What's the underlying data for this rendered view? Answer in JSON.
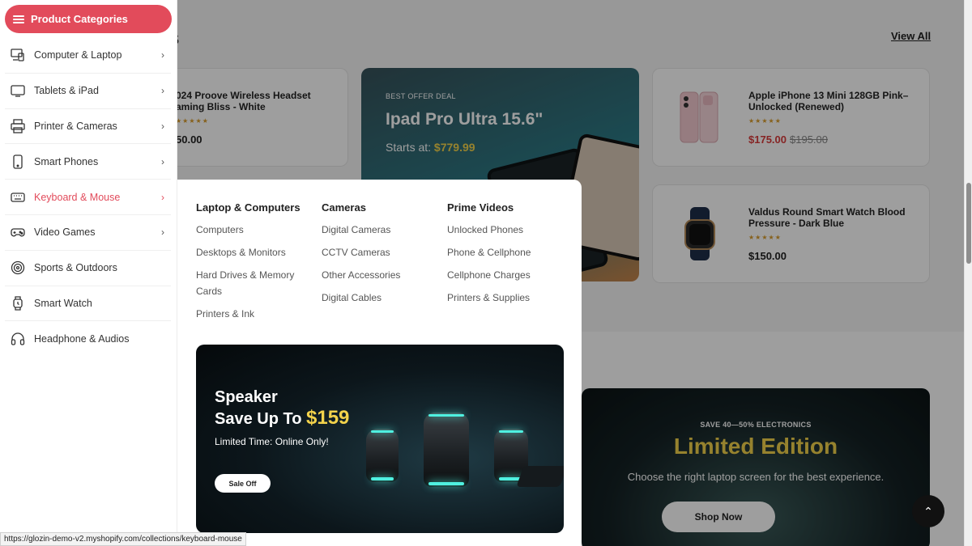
{
  "background": {
    "section_heading_partial": "s",
    "view_all": "View All",
    "products": [
      {
        "title": "024 Proove Wireless Headset\naming Bliss - White",
        "price": "50.00"
      },
      {
        "title": "Apple iPhone 13 Mini 128GB Pink–\nUnlocked (Renewed)",
        "price": "$175.00",
        "old_price": "$195.00"
      },
      {
        "title": "Valdus Round Smart Watch Blood\nPressure - Dark Blue",
        "price": "$150.00"
      }
    ],
    "promo": {
      "eyebrow": "BEST OFFER DEAL",
      "title": "Ipad Pro Ultra 15.6\"",
      "starts_label": "Starts at:",
      "starts_price": "$779.99"
    },
    "banner2": {
      "eyebrow": "SAVE 40—50% ELECTRONICS",
      "title": "Limited Edition",
      "subtitle": "Choose the right laptop screen for the best experience.",
      "button": "Shop Now"
    },
    "back_to_top": "⌃"
  },
  "sidebar": {
    "header": "Product Categories",
    "items": [
      {
        "label": "Computer & Laptop",
        "icon": "computer-icon",
        "has_sub": true
      },
      {
        "label": "Tablets & iPad",
        "icon": "tablet-icon",
        "has_sub": true
      },
      {
        "label": "Printer & Cameras",
        "icon": "printer-icon",
        "has_sub": true
      },
      {
        "label": "Smart Phones",
        "icon": "phone-icon",
        "has_sub": true
      },
      {
        "label": "Keyboard & Mouse",
        "icon": "keyboard-icon",
        "has_sub": true,
        "active": true
      },
      {
        "label": "Video Games",
        "icon": "gamepad-icon",
        "has_sub": true
      },
      {
        "label": "Sports & Outdoors",
        "icon": "sports-icon",
        "has_sub": false
      },
      {
        "label": "Smart Watch",
        "icon": "watch-icon",
        "has_sub": false
      },
      {
        "label": "Headphone & Audios",
        "icon": "headphone-icon",
        "has_sub": false
      }
    ]
  },
  "mega_menu": {
    "columns": [
      {
        "heading": "Laptop & Computers",
        "links": [
          "Computers",
          "Desktops & Monitors",
          "Hard Drives & Memory Cards",
          "Printers & Ink"
        ]
      },
      {
        "heading": "Cameras",
        "links": [
          "Digital Cameras",
          "CCTV Cameras",
          "Other Accessories",
          "Digital Cables"
        ]
      },
      {
        "heading": "Prime Videos",
        "links": [
          "Unlocked Phones",
          "Phone & Cellphone",
          "Cellphone Charges",
          "Printers & Supplies"
        ]
      }
    ],
    "banner": {
      "title_line1": "Speaker",
      "title_line2": "Save Up To",
      "price": "$159",
      "subtitle": "Limited Time: Online Only!",
      "button": "Sale Off"
    }
  },
  "status_url": "https://glozin-demo-v2.myshopify.com/collections/keyboard-mouse",
  "colors": {
    "accent": "#e24b5b",
    "highlight": "#f2d24b"
  }
}
